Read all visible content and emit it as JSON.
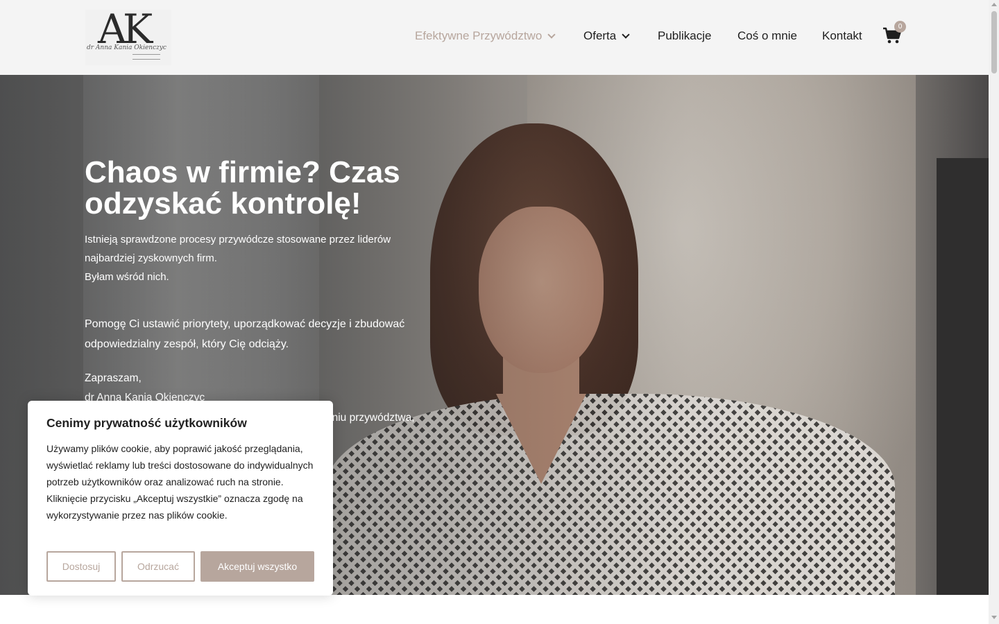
{
  "brand": {
    "monogram": "AK",
    "signature": "dr Anna Kania Okienczyc"
  },
  "nav": {
    "items": [
      {
        "label": "Efektywne Przywództwo",
        "has_dropdown": true,
        "active": true
      },
      {
        "label": "Oferta",
        "has_dropdown": true,
        "active": false
      },
      {
        "label": "Publikacje",
        "has_dropdown": false,
        "active": false
      },
      {
        "label": "Coś o mnie",
        "has_dropdown": false,
        "active": false
      },
      {
        "label": "Kontakt",
        "has_dropdown": false,
        "active": false
      }
    ],
    "cart_icon": "shopping-cart-icon",
    "cart_count": "0"
  },
  "hero": {
    "title": "Chaos w firmie? Czas odzyskać kontrolę!",
    "paragraph1": {
      "line1": "Istnieją sprawdzone procesy przywódcze stosowane przez liderów",
      "line2": "najbardziej zyskownych firm.",
      "line3": "Byłam wśród nich."
    },
    "paragraph2": {
      "line1": "Pomogę Ci ustawić priorytety, uporządkować decyzje i zbudować",
      "line2": "odpowiedzialny zespół, który Cię odciąży."
    },
    "paragraph3": {
      "line1": "Zapraszam,",
      "line2": "dr Anna Kania Okienczyc"
    },
    "paragraph3_partial": "aniu przywództwa,"
  },
  "cookie_banner": {
    "title": "Cenimy prywatność użytkowników",
    "text": "Używamy plików cookie, aby poprawić jakość przeglądania, wyświetlać reklamy lub treści dostosowane do indywidualnych potrzeb użytkowników oraz analizować ruch na stronie. Kliknięcie przycisku „Akceptuj wszystkie” oznacza zgodę na wykorzystywanie przez nas plików cookie.",
    "buttons": {
      "customize": "Dostosuj",
      "reject": "Odrzucać",
      "accept": "Akceptuj wszystko"
    }
  },
  "colors": {
    "accent": "#b7a69d",
    "header_bg": "#f4f4f4",
    "text_dark": "#1e1e1e"
  }
}
